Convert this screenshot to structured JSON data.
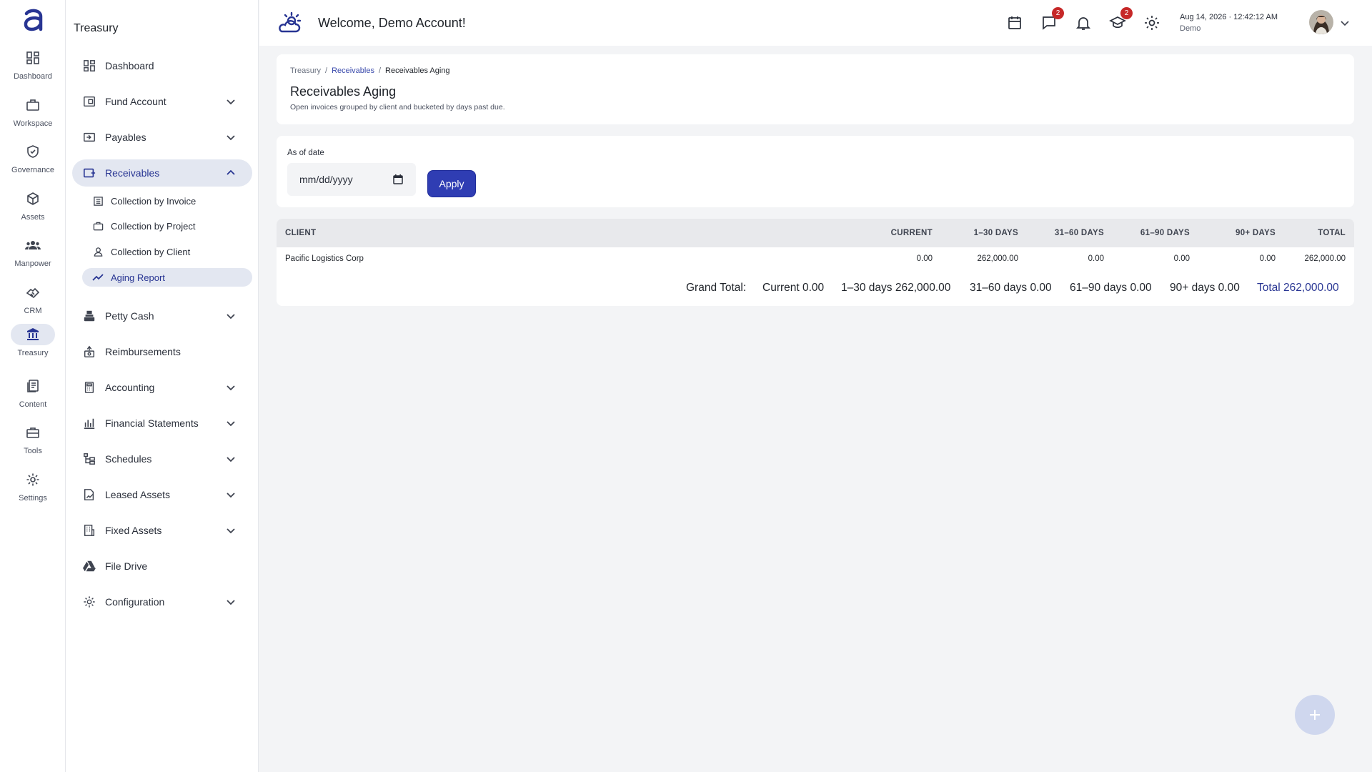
{
  "rail": {
    "items": [
      {
        "label": "Dashboard",
        "icon": "dashboard-icon"
      },
      {
        "label": "Workspace",
        "icon": "briefcase-icon"
      },
      {
        "label": "Governance",
        "icon": "shield-check-icon"
      },
      {
        "label": "Assets",
        "icon": "cube-icon"
      },
      {
        "label": "Manpower",
        "icon": "people-icon"
      },
      {
        "label": "CRM",
        "icon": "handshake-icon"
      },
      {
        "label": "Treasury",
        "icon": "bank-icon"
      },
      {
        "label": "Content",
        "icon": "document-icon"
      },
      {
        "label": "Tools",
        "icon": "toolbox-icon"
      },
      {
        "label": "Settings",
        "icon": "gear-icon"
      }
    ],
    "active": "Treasury"
  },
  "sidebar": {
    "title": "Treasury",
    "items": [
      {
        "label": "Dashboard"
      },
      {
        "label": "Fund Account"
      },
      {
        "label": "Payables"
      },
      {
        "label": "Receivables"
      },
      {
        "label": "Petty Cash"
      },
      {
        "label": "Reimbursements"
      },
      {
        "label": "Accounting"
      },
      {
        "label": "Financial Statements"
      },
      {
        "label": "Schedules"
      },
      {
        "label": "Leased Assets"
      },
      {
        "label": "Fixed Assets"
      },
      {
        "label": "File Drive"
      },
      {
        "label": "Configuration"
      }
    ],
    "receivables_sub": [
      {
        "label": "Collection by Invoice"
      },
      {
        "label": "Collection by Project"
      },
      {
        "label": "Collection by Client"
      },
      {
        "label": "Aging Report"
      }
    ]
  },
  "topbar": {
    "welcome": "Welcome, Demo Account!",
    "messages_badge": "2",
    "learning_badge": "2",
    "date": "Aug 14, 2026",
    "time": "12:42:12 AM",
    "user": "Demo"
  },
  "header": {
    "breadcrumb": [
      "Treasury",
      "Receivables",
      "Receivables Aging"
    ],
    "title": "Receivables Aging",
    "subtitle": "Open invoices grouped by client and bucketed by days past due."
  },
  "filter": {
    "label": "As of date",
    "placeholder": "mm/dd/yyyy",
    "apply_label": "Apply"
  },
  "table": {
    "columns": [
      "CLIENT",
      "CURRENT",
      "1–30 DAYS",
      "31–60 DAYS",
      "61–90 DAYS",
      "90+ DAYS",
      "TOTAL"
    ],
    "rows": [
      {
        "client": "Pacific Logistics Corp",
        "current": "0.00",
        "d1_30": "262,000.00",
        "d31_60": "0.00",
        "d61_90": "0.00",
        "d90p": "0.00",
        "total": "262,000.00"
      }
    ],
    "grand_total": {
      "label": "Grand Total:",
      "current": "Current 0.00",
      "d1_30": "1–30 days 262,000.00",
      "d31_60": "31–60 days 0.00",
      "d61_90": "61–90 days 0.00",
      "d90p": "90+ days 0.00",
      "total": "Total 262,000.00"
    }
  },
  "colors": {
    "accent": "#2f3db3",
    "active_bg": "#e3e7f1",
    "badge": "#c62828"
  }
}
